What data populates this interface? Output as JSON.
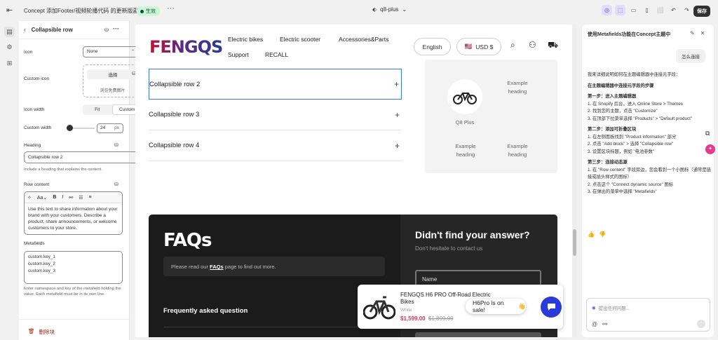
{
  "topbar": {
    "title": "Concept 添加Footer/视频轮播代码 的更新版副本",
    "status": "生效",
    "more": "···",
    "theme_selector": "q8-plus",
    "save": "保存"
  },
  "side_panel": {
    "title": "Collapsible row",
    "icon_label": "Icon",
    "icon_value": "None",
    "custom_icon_label": "Custom icon",
    "choose_label": "选择",
    "browse_label": "浏览免费图片",
    "icon_width_label": "Icon width",
    "icon_width_options": [
      "Fit",
      "Custom"
    ],
    "icon_width_selected": "Custom",
    "custom_width_label": "Custom width",
    "custom_width_value": "24",
    "custom_width_unit": "px",
    "custom_width_slider_fraction": 0.1,
    "heading_label": "Heading",
    "heading_value": "Collapsible row 2",
    "heading_help": "Include a heading that explains the content.",
    "row_content_label": "Row content",
    "row_content_text": "Use this text to share information about your brand with your customers. Describe a product, share announcements, or welcome customers to your store.",
    "metafields_label": "Metafields",
    "metafields_lines": [
      "custom.key_1",
      "custom.key_2",
      "custom.key_3"
    ],
    "metafields_help": "Enter namespace and key of the metafield holding the value. Each metafield must be in its own line.",
    "delete_label": "删除块"
  },
  "store": {
    "logo": "FENGQS",
    "nav": [
      "Electric bikes",
      "Electric scooter",
      "Accessories&Parts",
      "Support",
      "RECALL"
    ],
    "language": "English",
    "currency": "USD $",
    "rows": [
      "Collapsible row 2",
      "Collapsible row 3",
      "Collapsible row 4"
    ],
    "grid": {
      "top_right": "Example heading",
      "product": "Q8 Plus",
      "bottom_left": "Example heading",
      "bottom_right": "Example heading"
    },
    "faq": {
      "title": "FAQs",
      "read_prefix": "Please read our ",
      "read_link": "FAQs",
      "read_suffix": " page to find out more.",
      "frequent": "Frequently asked question",
      "didnt_find": "Didn't find your answer?",
      "contact": "Don't hesitate to contact us",
      "name_field": "Name"
    },
    "popup": {
      "product_name": "FENGQS H6 PRO Off-Road Electric Bikes",
      "variant": "White",
      "price": "$1,599.00",
      "old_price": "$1,899.00"
    },
    "sale_bubble": "H6Pro is on sale!",
    "sale_emoji": "👋"
  },
  "assistant": {
    "title": "使用Metafields功能在Concept主题中",
    "user_message": "怎么连接",
    "intro": "我来详细说明如何在主题编辑器中连接元字段：",
    "heading": "在主题编辑器中连接元字段的步骤",
    "step1_title": "第一步：进入主题编辑器",
    "step1_items": [
      "1. 在 Shopify 后台，进入 Online Store > Themes",
      "2. 找到您的主题，点击 \"Customize\"",
      "3. 在顶部下拉菜单选择 \"Products\" > \"Default product\""
    ],
    "step2_title": "第二步：添加可折叠区块",
    "step2_items": [
      "1. 在左侧面板找到 \"Product information\" 部分",
      "2. 点击 \"Add block\" > 选择 \"Collapsible row\"",
      "3. 设置区块标题，例如 \"电池参数\""
    ],
    "step3_title": "第三步：连接动态源",
    "step3_items": [
      "1. 在 \"Row content\" 字段旁边，您会看到一个小图标（通常是链接或插头样式的图标）",
      "2. 点击这个 \"Connect dynamic source\" 图标",
      "3. 在弹出的菜单中选择 \"Metafields\""
    ],
    "input_placeholder": "提出任何问题..."
  }
}
